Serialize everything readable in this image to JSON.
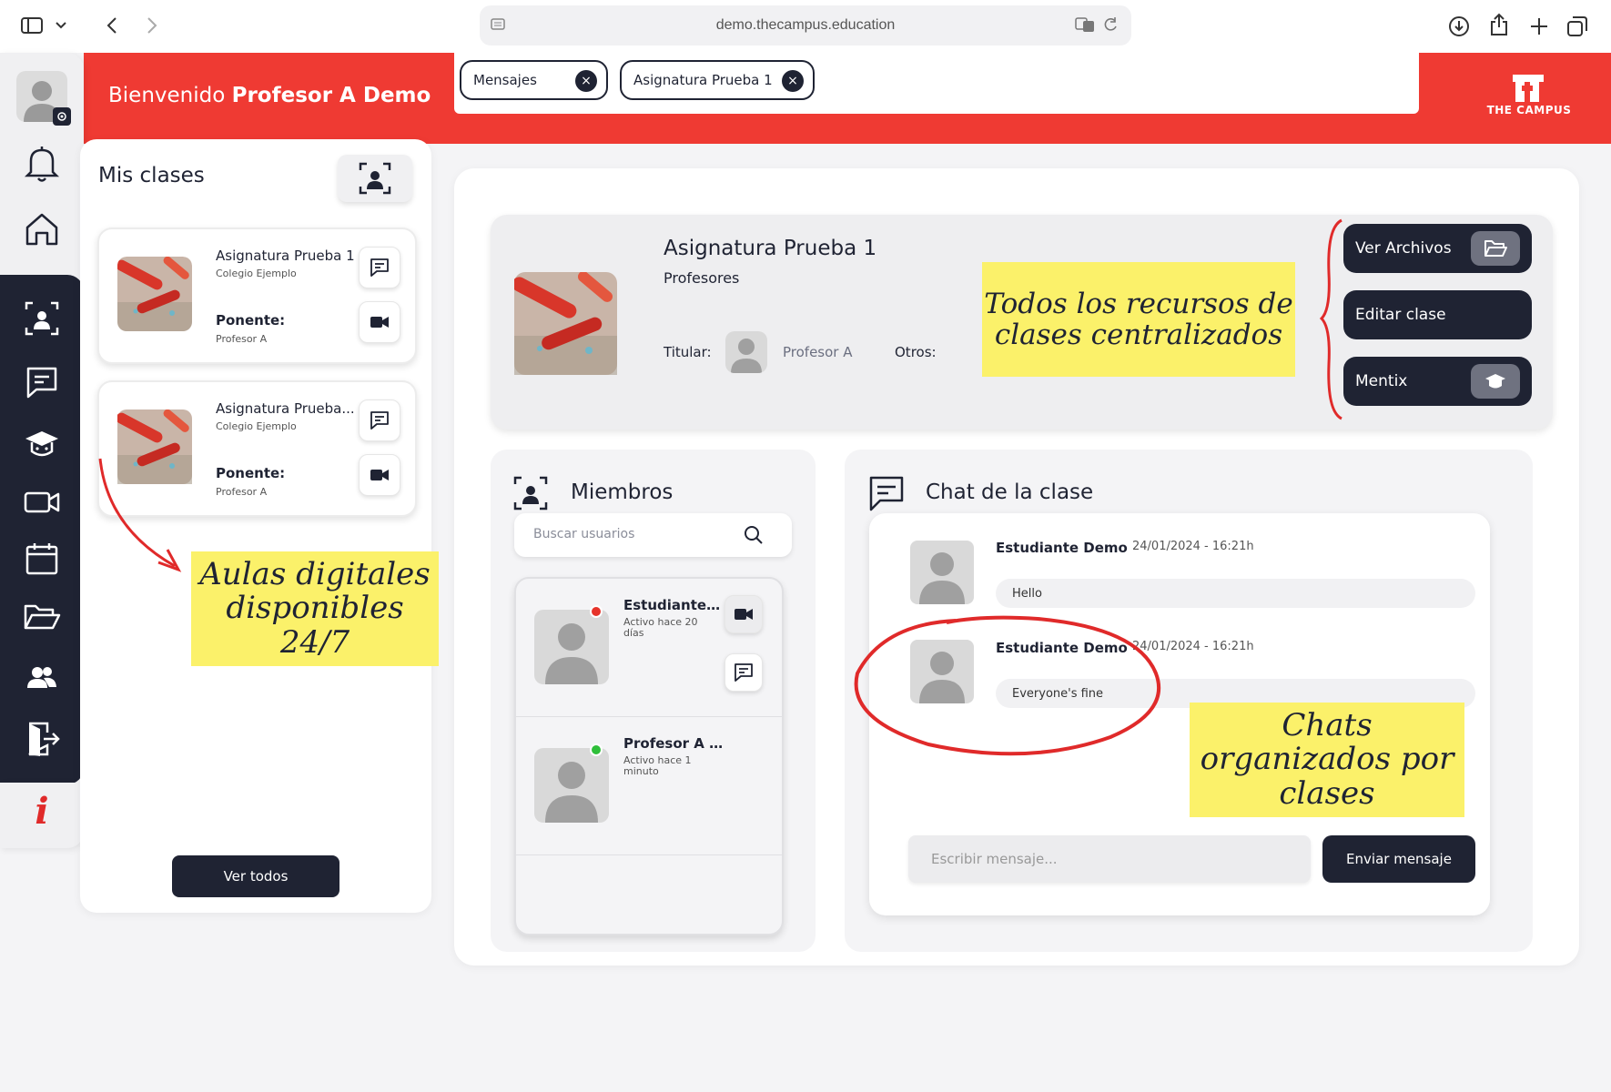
{
  "browser": {
    "url": "demo.thecampus.education"
  },
  "header": {
    "welcome_prefix": "Bienvenido",
    "welcome_name": "Profesor A Demo",
    "tabs": [
      {
        "label": "Mensajes"
      },
      {
        "label": "Asignatura Prueba 1"
      }
    ],
    "logo_text": "THE CAMPUS",
    "brand_color": "#ef3a33"
  },
  "sidebar": {
    "icons": [
      "profile-avatar",
      "bell-icon",
      "home-icon",
      "group-icon",
      "chat-icon",
      "graduation-cap-icon",
      "video-icon",
      "calendar-icon",
      "folder-icon",
      "users-icon",
      "logout-icon",
      "info-icon"
    ],
    "info_glyph": "i"
  },
  "clases": {
    "title": "Mis clases",
    "cards": [
      {
        "name": "Asignatura Prueba 1",
        "school": "Colegio Ejemplo",
        "ponente_label": "Ponente:",
        "ponente": "Profesor A"
      },
      {
        "name": "Asignatura Prueba...",
        "school": "Colegio Ejemplo",
        "ponente_label": "Ponente:",
        "ponente": "Profesor A"
      }
    ],
    "ver_todos": "Ver todos"
  },
  "notes": {
    "aulas": "Aulas digitales disponibles 24/7",
    "recursos": "Todos los recursos de clases centralizados",
    "chats": "Chats organizados por clases"
  },
  "subject": {
    "title": "Asignatura Prueba 1",
    "subtitle": "Profesores",
    "titular_label": "Titular:",
    "titular_name": "Profesor A",
    "otros_label": "Otros:",
    "actions": [
      {
        "label": "Ver Archivos",
        "icon": "folder-icon"
      },
      {
        "label": "Editar clase"
      },
      {
        "label": "Mentix",
        "icon": "graduation-cap-icon"
      }
    ]
  },
  "members": {
    "title": "Miembros",
    "search_placeholder": "Buscar usuarios",
    "list": [
      {
        "name": "Estudiante D...",
        "status": "Activo hace 20 días",
        "online": false
      },
      {
        "name": "Profesor A D...",
        "status": "Activo hace 1 minuto",
        "online": true
      }
    ]
  },
  "chat": {
    "title": "Chat de la clase",
    "messages": [
      {
        "author": "Estudiante Demo",
        "time": "24/01/2024 - 16:21h",
        "text": "Hello"
      },
      {
        "author": "Estudiante Demo",
        "time": "24/01/2024 - 16:21h",
        "text": "Everyone's fine"
      }
    ],
    "input_placeholder": "Escribir mensaje...",
    "send_label": "Enviar mensaje"
  }
}
